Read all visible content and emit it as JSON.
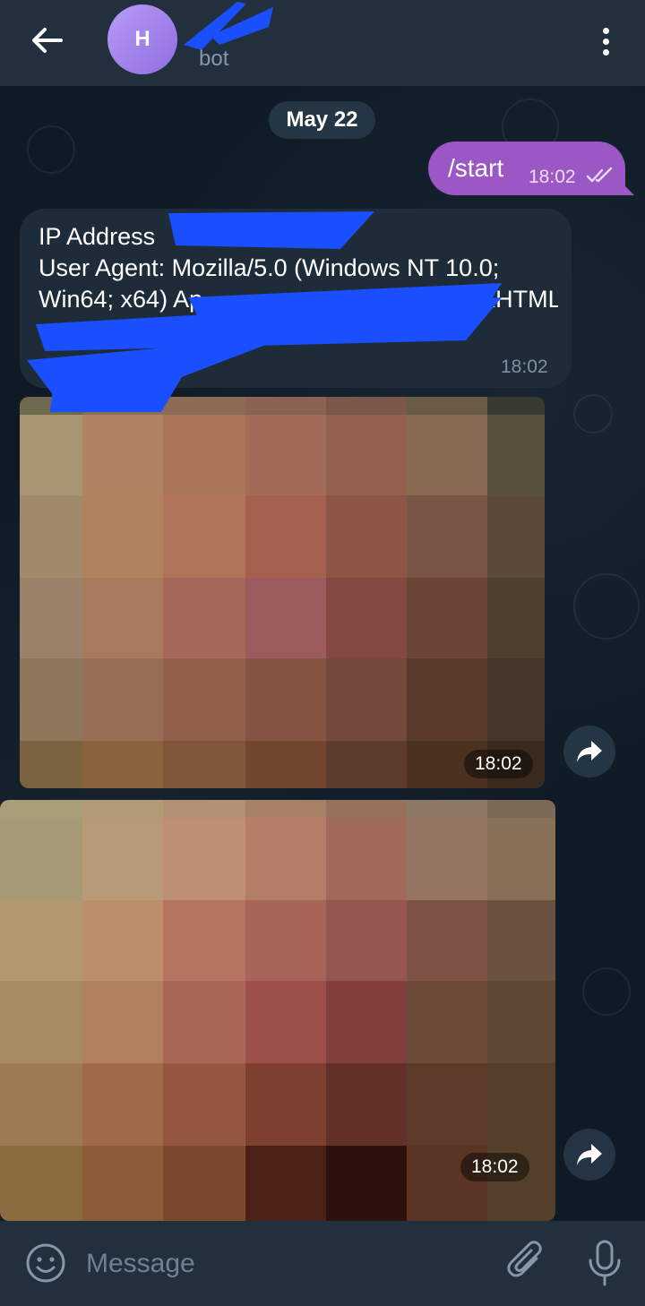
{
  "header": {
    "avatar_initial": "H",
    "subtitle": "bot",
    "icons": {
      "back": "arrow-left-icon",
      "menu": "vertical-dots-icon"
    }
  },
  "date_separator": "May 22",
  "messages": [
    {
      "direction": "outgoing",
      "text": "/start",
      "time": "18:02",
      "status": "read"
    },
    {
      "direction": "incoming",
      "lines": [
        "IP Address",
        "User Agent: Mozilla/5.0 (Windows NT 10.0;",
        "Win64; x64) Ap",
        "(KHTML,"
      ],
      "time": "18:02"
    },
    {
      "direction": "incoming",
      "type": "photo",
      "time": "18:02"
    },
    {
      "direction": "incoming",
      "type": "photo",
      "time": "18:02"
    }
  ],
  "composer": {
    "placeholder": "Message",
    "icons": {
      "emoji": "smiley-icon",
      "attach": "paperclip-icon",
      "mic": "microphone-icon"
    }
  },
  "colors": {
    "header": "#222f3c",
    "outgoing_bubble": "#9b58c5",
    "incoming_bubble": "#1e2c3a",
    "redaction": "#1a4fff"
  }
}
